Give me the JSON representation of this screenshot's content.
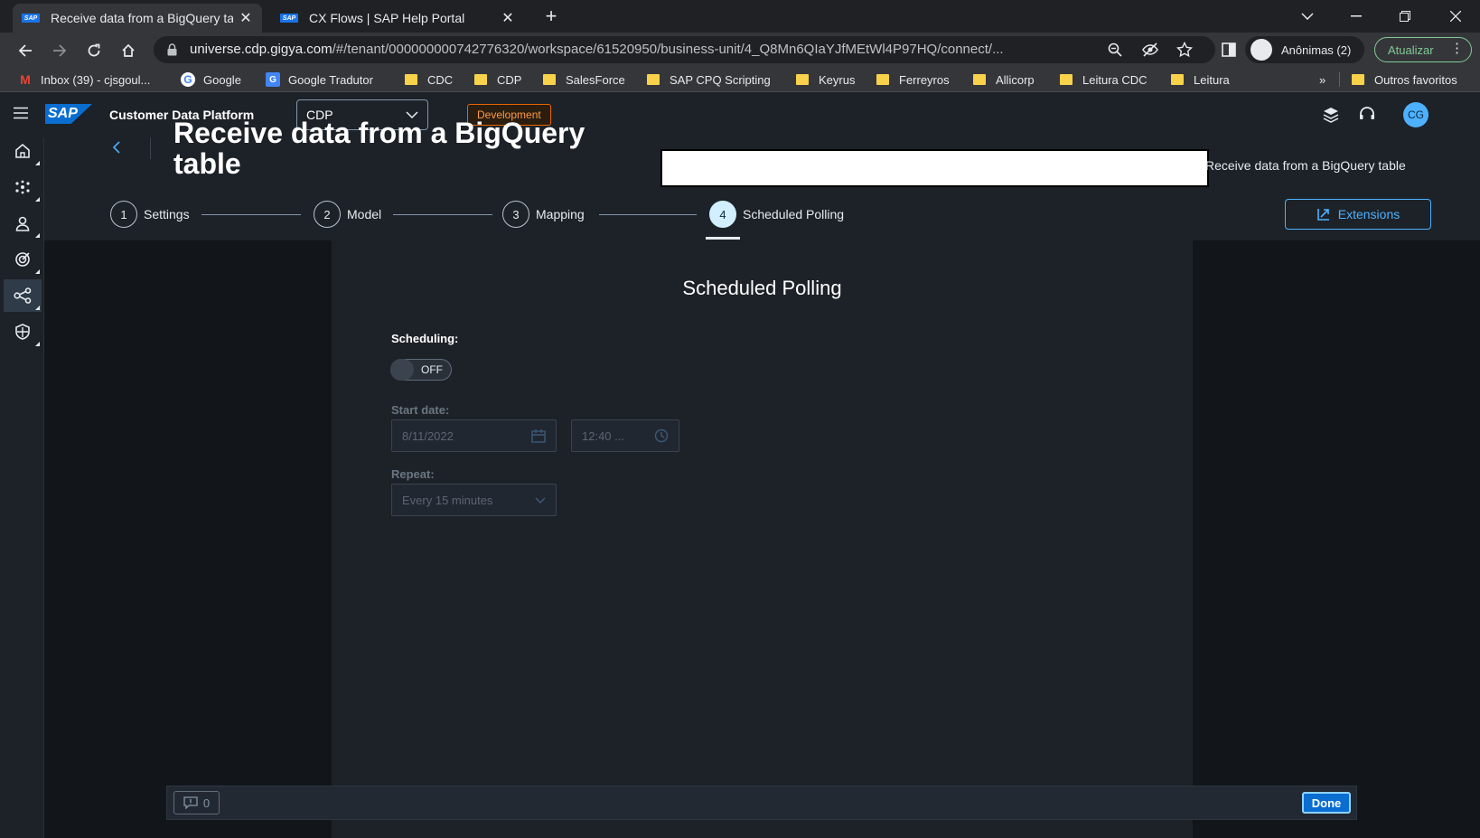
{
  "browser": {
    "tabs": [
      {
        "title": "Receive data from a BigQuery tal",
        "close": "✕"
      },
      {
        "title": "CX Flows | SAP Help Portal",
        "close": "✕"
      }
    ],
    "new_tab": "+",
    "url_host": "universe.cdp.gigya.com",
    "url_path": "/#/tenant/000000000742776320/workspace/61520950/business-unit/4_Q8Mn6QIaYJfMEtWl4P97HQ/connect/...",
    "profile_label": "Anônimas (2)",
    "update_label": "Atualizar",
    "bookmarks": [
      {
        "label": "Inbox (39) - cjsgoul...",
        "icon": "gmail-icon"
      },
      {
        "label": "Google",
        "icon": "google-icon"
      },
      {
        "label": "Google Tradutor",
        "icon": "translate-icon"
      },
      {
        "label": "CDC",
        "icon": "folder-icon"
      },
      {
        "label": "CDP",
        "icon": "folder-icon"
      },
      {
        "label": "SalesForce",
        "icon": "folder-icon"
      },
      {
        "label": "SAP CPQ Scripting",
        "icon": "folder-icon"
      },
      {
        "label": "Keyrus",
        "icon": "folder-icon"
      },
      {
        "label": "Ferreyros",
        "icon": "folder-icon"
      },
      {
        "label": "Allicorp",
        "icon": "folder-icon"
      },
      {
        "label": "Leitura CDC",
        "icon": "folder-icon"
      },
      {
        "label": "Leitura",
        "icon": "folder-icon"
      }
    ],
    "bookmarks_overflow": "»",
    "other_bookmarks": "Outros favoritos"
  },
  "shell": {
    "logo": "SAP",
    "product_name": "Customer Data Platform",
    "business_unit_selected": "CDP",
    "environment_badge": "Development",
    "avatar_initials": "CG"
  },
  "page": {
    "title": "Receive data from a BigQuery table",
    "breadcrumb_current": "Receive data from a BigQuery table",
    "steps": [
      {
        "number": "1",
        "label": "Settings"
      },
      {
        "number": "2",
        "label": "Model"
      },
      {
        "number": "3",
        "label": "Mapping"
      },
      {
        "number": "4",
        "label": "Scheduled Polling"
      }
    ],
    "extensions_label": "Extensions"
  },
  "form": {
    "section_title": "Scheduled Polling",
    "scheduling_label": "Scheduling:",
    "scheduling_state": "OFF",
    "start_date_label": "Start date:",
    "start_date_value": "8/11/2022",
    "start_time_value": "12:40 ...",
    "repeat_label": "Repeat:",
    "repeat_value": "Every 15 minutes"
  },
  "footer": {
    "message_count": "0",
    "done_label": "Done"
  },
  "colors": {
    "shell_bg": "#1d2228",
    "page_bg": "#12161b",
    "accent": "#0a6ed1",
    "link": "#4db1ff",
    "dev_badge": "#e76500"
  }
}
